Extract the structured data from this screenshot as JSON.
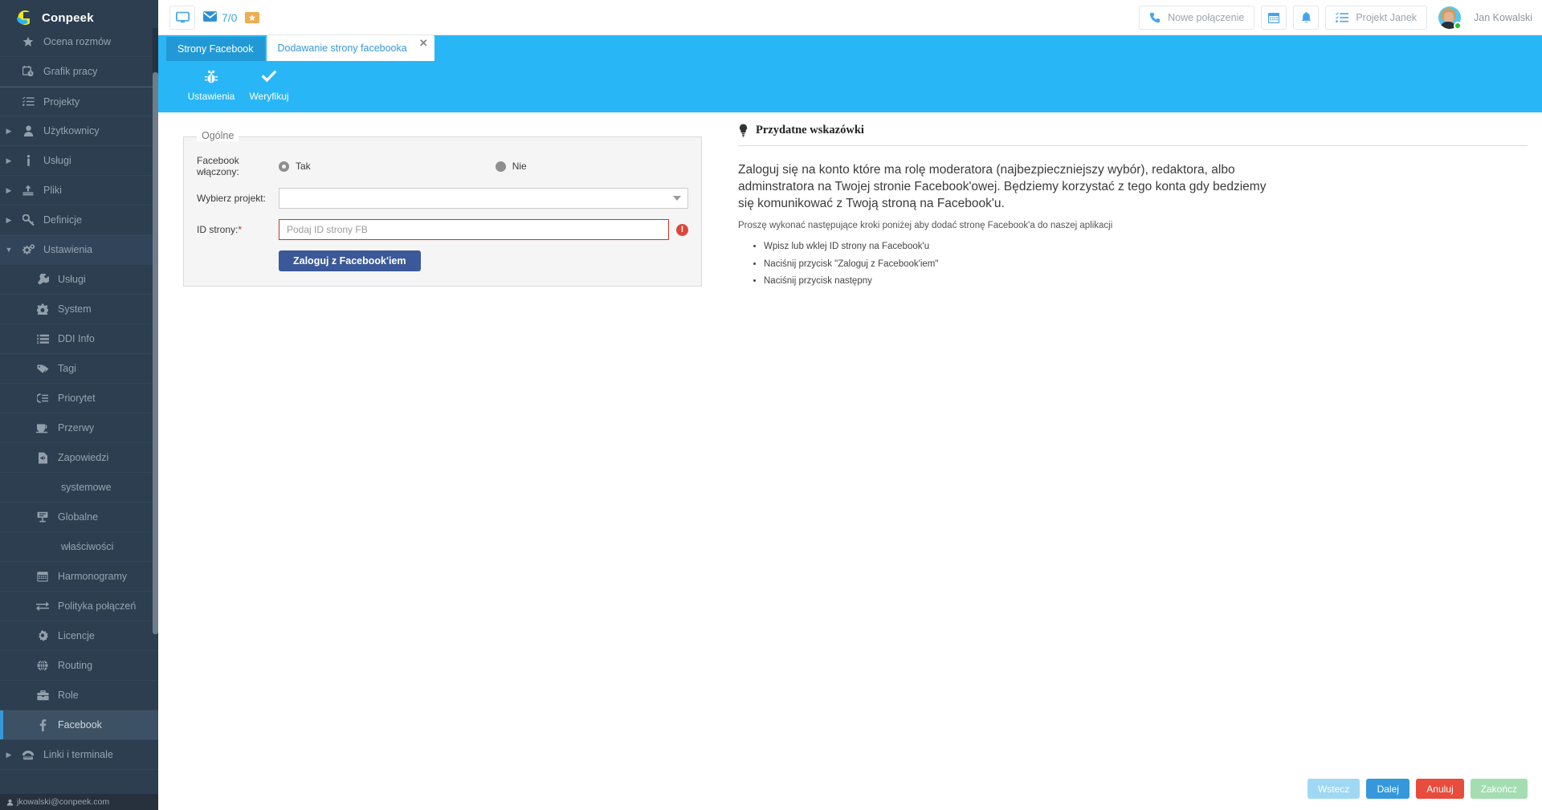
{
  "brand": {
    "name": "Conpeek",
    "logo_icon": "conpeek-logo-icon"
  },
  "sidebar": {
    "items": [
      {
        "label": "Ocena rozmów",
        "icon": "star-icon",
        "level": "top",
        "caret": false,
        "active": false
      },
      {
        "label": "Grafik pracy",
        "icon": "calendar-clock-icon",
        "level": "top",
        "caret": false,
        "active": false
      },
      {
        "label": "Projekty",
        "icon": "task-list-icon",
        "level": "top",
        "caret": false,
        "active": false,
        "separator": true
      },
      {
        "label": "Użytkownicy",
        "icon": "user-icon",
        "level": "top",
        "caret": true,
        "active": false
      },
      {
        "label": "Usługi",
        "icon": "info-icon",
        "level": "top",
        "caret": true,
        "active": false
      },
      {
        "label": "Pliki",
        "icon": "upload-icon",
        "level": "top",
        "caret": true,
        "active": false
      },
      {
        "label": "Definicje",
        "icon": "key-icon",
        "level": "top",
        "caret": true,
        "active": false
      },
      {
        "label": "Ustawienia",
        "icon": "gears-icon",
        "level": "top",
        "caret": true,
        "expanded": true,
        "active": false
      },
      {
        "label": "Usługi",
        "icon": "wrench-icon",
        "level": "child",
        "caret": false,
        "active": false
      },
      {
        "label": "System",
        "icon": "gear-icon",
        "level": "child",
        "caret": false,
        "active": false
      },
      {
        "label": "DDI Info",
        "icon": "ordered-list-icon",
        "level": "child",
        "caret": false,
        "active": false
      },
      {
        "label": "Tagi",
        "icon": "tags-icon",
        "level": "child",
        "caret": false,
        "active": false
      },
      {
        "label": "Priorytet",
        "icon": "priority-icon",
        "level": "child",
        "caret": false,
        "active": false
      },
      {
        "label": "Przerwy",
        "icon": "coffee-icon",
        "level": "child",
        "caret": false,
        "active": false
      },
      {
        "label": "Zapowiedzi",
        "icon": "audio-file-icon",
        "level": "child",
        "caret": false,
        "active": false
      },
      {
        "label": "systemowe",
        "icon": "none",
        "level": "child2",
        "caret": false,
        "active": false
      },
      {
        "label": "Globalne",
        "icon": "sign-icon",
        "level": "child",
        "caret": false,
        "active": false
      },
      {
        "label": "właściwości",
        "icon": "none",
        "level": "child2",
        "caret": false,
        "active": false
      },
      {
        "label": "Harmonogramy",
        "icon": "calendar-icon",
        "level": "child",
        "caret": false,
        "active": false
      },
      {
        "label": "Polityka połączeń",
        "icon": "exchange-icon",
        "level": "child",
        "caret": false,
        "active": false
      },
      {
        "label": "Licencje",
        "icon": "certificate-icon",
        "level": "child",
        "caret": false,
        "active": false
      },
      {
        "label": "Routing",
        "icon": "globe-icon",
        "level": "child",
        "caret": false,
        "active": false
      },
      {
        "label": "Role",
        "icon": "briefcase-icon",
        "level": "child",
        "caret": false,
        "active": false
      },
      {
        "label": "Facebook",
        "icon": "facebook-icon",
        "level": "child",
        "caret": false,
        "active": true
      },
      {
        "label": "Linki i terminale",
        "icon": "phone-terminal-icon",
        "level": "top",
        "caret": true,
        "active": false
      }
    ],
    "footer_user": "jkowalski@conpeek.com"
  },
  "topbar": {
    "monitor_icon": "monitor-icon",
    "mail_icon": "envelope-icon",
    "mail_count": "7/0",
    "ticket_icon": "ticket-icon",
    "new_call_label": "Nowe połączenie",
    "phone_icon": "phone-icon",
    "calendar_icon": "calendar-icon",
    "bell_icon": "bell-icon",
    "project_label": "Projekt Janek",
    "project_icon": "task-list-icon",
    "user_name": "Jan Kowalski",
    "avatar_icon": "avatar",
    "status": "online"
  },
  "tabs": [
    {
      "label": "Strony Facebook",
      "active": false,
      "closable": false
    },
    {
      "label": "Dodawanie strony facebooka",
      "active": true,
      "closable": true,
      "close_icon": "close-icon"
    }
  ],
  "steps": [
    {
      "label": "Ustawienia",
      "icon": "bug-settings-icon",
      "active": true
    },
    {
      "label": "Weryfikuj",
      "icon": "check-icon",
      "active": false
    }
  ],
  "form": {
    "legend": "Ogólne",
    "enabled_label": "Facebook włączony:",
    "enabled_options": [
      {
        "label": "Tak",
        "selected": true
      },
      {
        "label": "Nie",
        "selected": false
      }
    ],
    "project_label": "Wybierz projekt:",
    "project_value": "",
    "page_id_label": "ID strony:",
    "page_id_required": "*",
    "page_id_placeholder": "Podaj ID strony FB",
    "page_id_value": "",
    "error_icon": "error-exclamation-icon",
    "fb_login_label": "Zaloguj z Facebook'iem",
    "fb_brand_color": "#3b5998"
  },
  "tips": {
    "title": "Przydatne wskazówki",
    "bulb_icon": "lightbulb-icon",
    "lead": "Zaloguj się na konto które ma rolę moderatora (najbezpieczniejszy wybór), redaktora, albo adminstratora na Twojej stronie Facebook'owej. Będziemy korzystać z tego konta gdy bedziemy się komunikować z Twoją stroną na Facebook'u.",
    "sub": "Proszę wykonać następujące kroki poniżej aby dodać stronę Facebook'a do naszej aplikacji",
    "steps": [
      "Wpisz lub wklej ID strony na Facebook'u",
      "Naciśnij przycisk \"Zaloguj z Facebook'iem\"",
      "Naciśnij przycisk następny"
    ]
  },
  "footer_buttons": [
    {
      "label": "Wstecz",
      "style": "back"
    },
    {
      "label": "Dalej",
      "style": "next"
    },
    {
      "label": "Anuluj",
      "style": "cancel"
    },
    {
      "label": "Zakończ",
      "style": "finish"
    }
  ],
  "colors": {
    "sidebar_bg": "#2c3e50",
    "accent_blue": "#29b6f6",
    "facebook_blue": "#3b5998",
    "error_red": "#c0392b"
  }
}
